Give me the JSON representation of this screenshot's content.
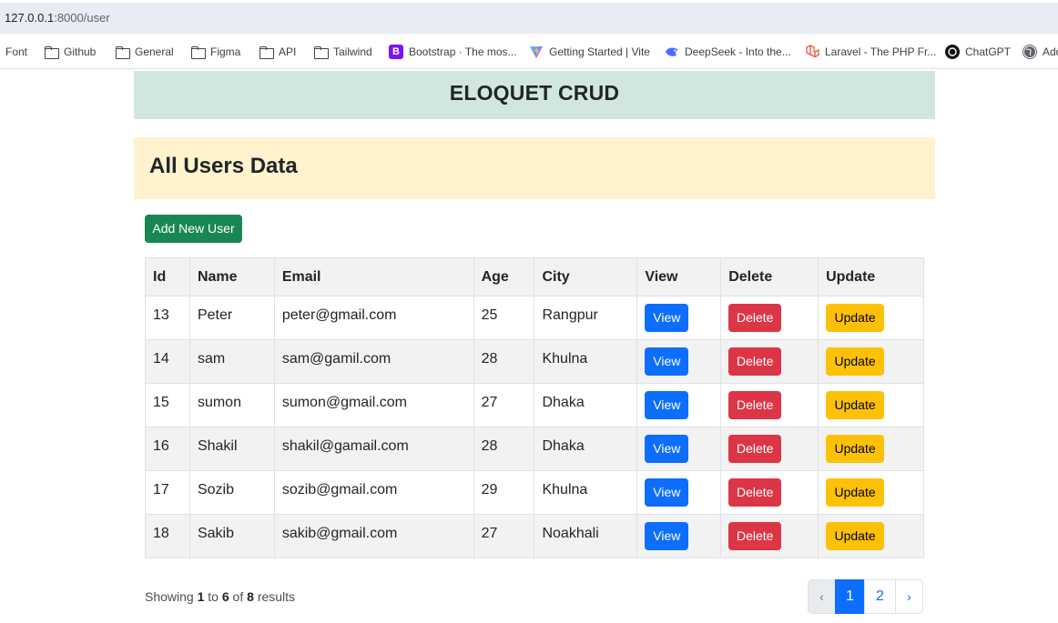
{
  "browser": {
    "url_host": "127.0.0.1",
    "url_path": ":8000/user",
    "bookmarks": [
      {
        "label": "Font",
        "icon": "none"
      },
      {
        "label": "Github",
        "icon": "folder-icon"
      },
      {
        "label": "General",
        "icon": "folder-icon"
      },
      {
        "label": "Figma",
        "icon": "folder-icon"
      },
      {
        "label": "API",
        "icon": "folder-icon"
      },
      {
        "label": "Tailwind",
        "icon": "folder-icon"
      },
      {
        "label": "Bootstrap · The mos...",
        "icon": "bootstrap-icon"
      },
      {
        "label": "Getting Started | Vite",
        "icon": "vite-icon"
      },
      {
        "label": "DeepSeek - Into the...",
        "icon": "deepseek-icon"
      },
      {
        "label": "Laravel - The PHP Fr...",
        "icon": "laravel-icon"
      },
      {
        "label": "ChatGPT",
        "icon": "chatgpt-icon"
      },
      {
        "label": "Add",
        "icon": "globe-icon"
      }
    ]
  },
  "header": {
    "title": "ELOQUET CRUD"
  },
  "section": {
    "title": "All Users Data"
  },
  "actions": {
    "add_label": "Add New User"
  },
  "table": {
    "columns": [
      "Id",
      "Name",
      "Email",
      "Age",
      "City",
      "View",
      "Delete",
      "Update"
    ],
    "rows": [
      {
        "id": "13",
        "name": "Peter",
        "email": "peter@gmail.com",
        "age": "25",
        "city": "Rangpur"
      },
      {
        "id": "14",
        "name": "sam",
        "email": "sam@gamil.com",
        "age": "28",
        "city": "Khulna"
      },
      {
        "id": "15",
        "name": "sumon",
        "email": "sumon@gmail.com",
        "age": "27",
        "city": "Dhaka"
      },
      {
        "id": "16",
        "name": "Shakil",
        "email": "shakil@gamail.com",
        "age": "28",
        "city": "Dhaka"
      },
      {
        "id": "17",
        "name": "Sozib",
        "email": "sozib@gmail.com",
        "age": "29",
        "city": "Khulna"
      },
      {
        "id": "18",
        "name": "Sakib",
        "email": "sakib@gmail.com",
        "age": "27",
        "city": "Noakhali"
      }
    ],
    "view_label": "View",
    "delete_label": "Delete",
    "update_label": "Update"
  },
  "footer": {
    "showing_prefix": "Showing",
    "from": "1",
    "to_word": "to",
    "to": "6",
    "of_word": "of",
    "total": "8",
    "results_word": "results"
  },
  "pagination": {
    "prev": "‹",
    "pages": [
      "1",
      "2"
    ],
    "active_page": "1",
    "next": "›"
  },
  "colors": {
    "header_bg": "#d1e7dd",
    "section_bg": "#fff3cd",
    "add_button": "#198754",
    "view_button": "#0d6efd",
    "delete_button": "#dc3545",
    "update_button": "#ffc107"
  }
}
